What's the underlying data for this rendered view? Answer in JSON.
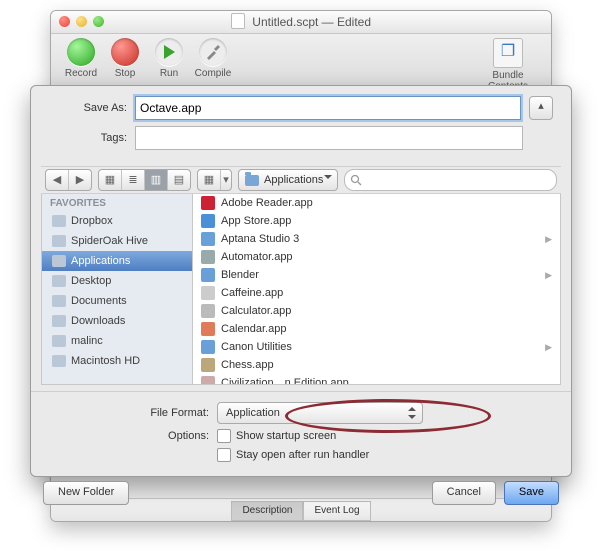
{
  "title": {
    "text": "Untitled.scpt",
    "suffix": " — Edited"
  },
  "toolbar": {
    "record": "Record",
    "stop": "Stop",
    "run": "Run",
    "compile": "Compile",
    "bundle": "Bundle Contents"
  },
  "save": {
    "saveAsLabel": "Save As:",
    "saveAsValue": "Octave.app",
    "tagsLabel": "Tags:",
    "tagsValue": "",
    "expand_icon": "▴"
  },
  "browser": {
    "location": "Applications",
    "search_placeholder": "",
    "favorites_header": "FAVORITES",
    "favorites": [
      {
        "label": "Dropbox"
      },
      {
        "label": "SpiderOak Hive"
      },
      {
        "label": "Applications",
        "selected": true
      },
      {
        "label": "Desktop"
      },
      {
        "label": "Documents"
      },
      {
        "label": "Downloads"
      },
      {
        "label": "malinc"
      },
      {
        "label": "Macintosh HD"
      }
    ],
    "files": [
      {
        "label": "Adobe Reader.app",
        "color": "#c23"
      },
      {
        "label": "App Store.app",
        "color": "#4a90d9"
      },
      {
        "label": "Aptana Studio 3",
        "color": "#6aa0d8",
        "folder": true
      },
      {
        "label": "Automator.app",
        "color": "#9aa"
      },
      {
        "label": "Blender",
        "color": "#6aa0d8",
        "folder": true
      },
      {
        "label": "Caffeine.app",
        "color": "#ccc"
      },
      {
        "label": "Calculator.app",
        "color": "#bbb"
      },
      {
        "label": "Calendar.app",
        "color": "#e07b5a"
      },
      {
        "label": "Canon Utilities",
        "color": "#6aa0d8",
        "folder": true
      },
      {
        "label": "Chess.app",
        "color": "#bca77a"
      },
      {
        "label": "Civilization…n Edition.app",
        "color": "#caa"
      }
    ]
  },
  "format": {
    "fileFormatLabel": "File Format:",
    "fileFormatValue": "Application",
    "optionsLabel": "Options:",
    "opt1": "Show startup screen",
    "opt2": "Stay open after run handler"
  },
  "buttons": {
    "newFolder": "New Folder",
    "cancel": "Cancel",
    "save": "Save"
  },
  "tabs": {
    "desc": "Description",
    "log": "Event Log"
  }
}
